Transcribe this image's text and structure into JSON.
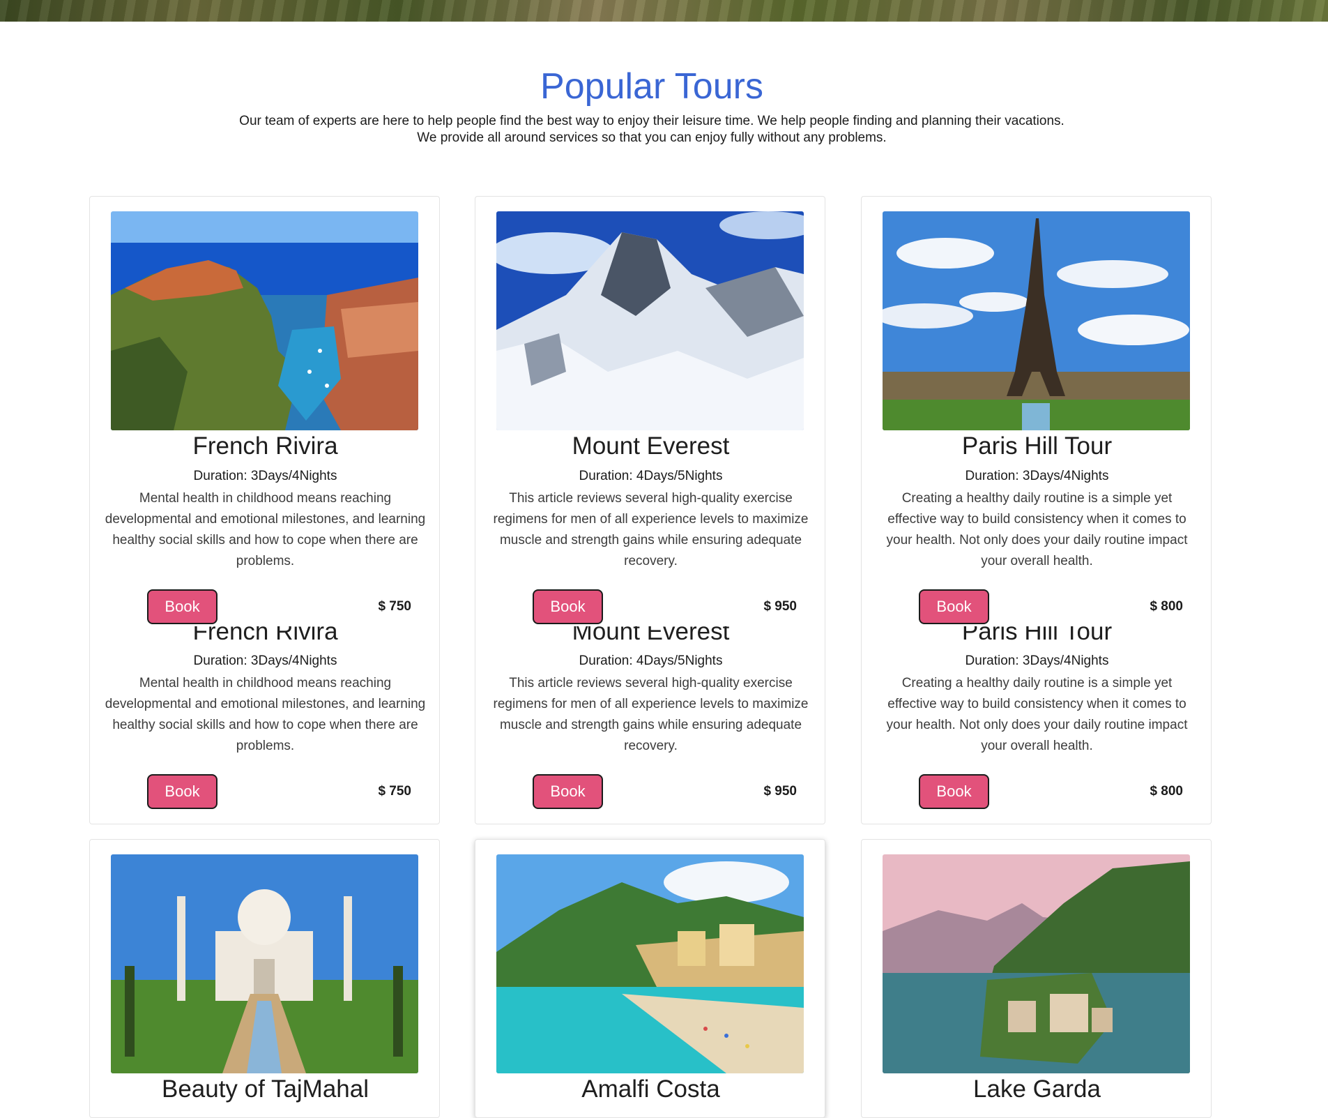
{
  "section": {
    "title": "Popular Tours",
    "subtitle_line1": "Our team of experts are here to help people find the best way to enjoy their leisure time. We help people finding and planning their vacations.",
    "subtitle_line2": "We provide all around services so that you can enjoy fully without any problems."
  },
  "tours": [
    {
      "title": "French Rivira",
      "duration": "Duration: 3Days/4Nights",
      "description": "Mental health in childhood means reaching developmental and emotional milestones, and learning healthy social skills and how to cope when there are problems.",
      "book_label": "Book",
      "price": "$ 750"
    },
    {
      "title": "Mount Everest",
      "duration": "Duration: 4Days/5Nights",
      "description": "This article reviews several high-quality exercise regimens for men of all experience levels to maximize muscle and strength gains while ensuring adequate recovery.",
      "book_label": "Book",
      "price": "$ 950"
    },
    {
      "title": "Paris Hill Tour",
      "duration": "Duration: 3Days/4Nights",
      "description": "Creating a healthy daily routine is a simple yet effective way to build consistency when it comes to your health. Not only does your daily routine impact your overall health.",
      "book_label": "Book",
      "price": "$ 800"
    },
    {
      "title": "Beauty of TajMahal"
    },
    {
      "title": "Amalfi Costa"
    },
    {
      "title": "Lake Garda"
    }
  ]
}
